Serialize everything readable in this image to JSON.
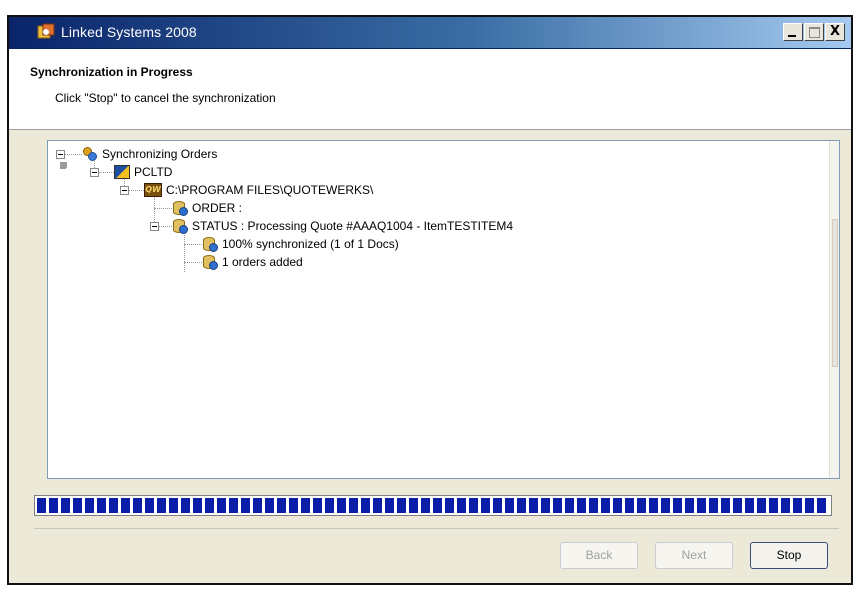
{
  "window": {
    "title": "Linked Systems 2008",
    "caption_buttons": {
      "minimize": "",
      "maximize": "",
      "close": "X"
    }
  },
  "header": {
    "title": "Synchronization in Progress",
    "subtitle": "Click \"Stop\" to cancel the synchronization"
  },
  "tree": {
    "nodes": [
      {
        "label": "Synchronizing Orders",
        "icon": "sync-gears-icon",
        "level": 0
      },
      {
        "label": "PCLTD",
        "icon": "company-flag-icon",
        "level": 1
      },
      {
        "label": "C:\\PROGRAM FILES\\QUOTEWERKS\\",
        "icon": "quotewerks-icon",
        "level": 2
      },
      {
        "label": "ORDER :",
        "icon": "database-gear-icon",
        "level": 3
      },
      {
        "label": "STATUS : Processing Quote #AAAQ1004 - ItemTESTITEM4",
        "icon": "database-gear-icon",
        "level": 3
      },
      {
        "label": "100% synchronized (1 of 1 Docs)",
        "icon": "database-gear-icon",
        "level": 4
      },
      {
        "label": "1 orders added",
        "icon": "database-gear-icon",
        "level": 4
      }
    ]
  },
  "progress": {
    "value_percent": 100,
    "color": "#0a1ea8"
  },
  "buttons": {
    "back": "Back",
    "next": "Next",
    "stop": "Stop"
  }
}
